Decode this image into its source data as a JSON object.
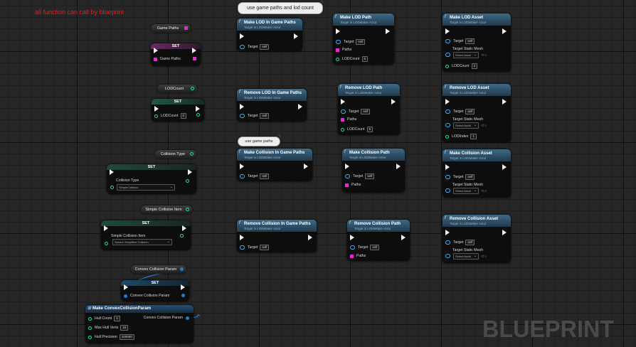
{
  "note": "all function can call by blueprint",
  "watermark": "BLUEPRINT",
  "comments": {
    "c1": "use game paths and lod count",
    "c2": "use game paths"
  },
  "vars": {
    "game_paths": "Game Paths",
    "lod_count": "LODCount",
    "collision_type": "Collision Type",
    "simple_collision_item": "Simple Collision Item",
    "convex_collision_param": "Convex Collision Param"
  },
  "set_label": "SET",
  "set_nodes": {
    "game_paths_pin": "Game Paths",
    "lod_count_pin": "LODCount",
    "lod_count_value": "0",
    "collision_type_pin": "Collision Type",
    "collision_type_value": "SimpleCollision",
    "simple_collision_pin": "Simple Collision Item",
    "simple_collision_value": "Sphere Simplified Collision",
    "convex_param_pin": "Convex Collision Param"
  },
  "target_line": "Target is LODMaker Actor",
  "pins": {
    "target": "Target",
    "self": "self",
    "paths": "Paths",
    "lod_count": "LODCount",
    "target_static_mesh": "Target Static Mesh",
    "select_asset": "Select Asset",
    "lod_index": "LODIndex"
  },
  "functions": {
    "make_lod_in_game_paths": "Make LOD In Game Paths",
    "make_lod_path": "Make LOD Path",
    "make_lod_asset": "Make LOD Asset",
    "remove_lod_in_game_paths": "Remove LOD In Game Paths",
    "remove_lod_path": "Remove LOD Path",
    "remove_lod_asset": "Remove LOD Asset",
    "make_collision_in_game_paths": "Make Collision In Game Paths",
    "make_collision_path": "Make Collision Path",
    "make_collision_asset": "Make Collision Asset",
    "remove_collision_in_game_paths": "Remove Collision In Game Paths",
    "remove_collision_path": "Remove Collision Path",
    "remove_collision_asset": "Remove Collision Asset"
  },
  "values": {
    "make_lod_path_lodcount": "5",
    "make_lod_asset_lodcount": "3",
    "remove_lod_path_lodcount": "5",
    "remove_lod_asset_lodindex": "1"
  },
  "make_convex": {
    "title": "Make ConvexCollisionParam",
    "hull_count_label": "Hull Count",
    "hull_count": "4",
    "max_hull_verts_label": "Max Hull Verts",
    "max_hull_verts": "16",
    "hull_precision_label": "Hull Precision",
    "hull_precision": "100000",
    "output_label": "Convex Collision Param"
  },
  "colors": {
    "background": "#262626",
    "exec_pin": "#eeeeee",
    "object_pin": "#3bb5ff",
    "array_pin": "#e32bd0",
    "int_pin": "#1fe2a0",
    "struct_pin": "#1d7cd6",
    "function_header": "#3c6987",
    "note_text": "#f21a1a"
  }
}
